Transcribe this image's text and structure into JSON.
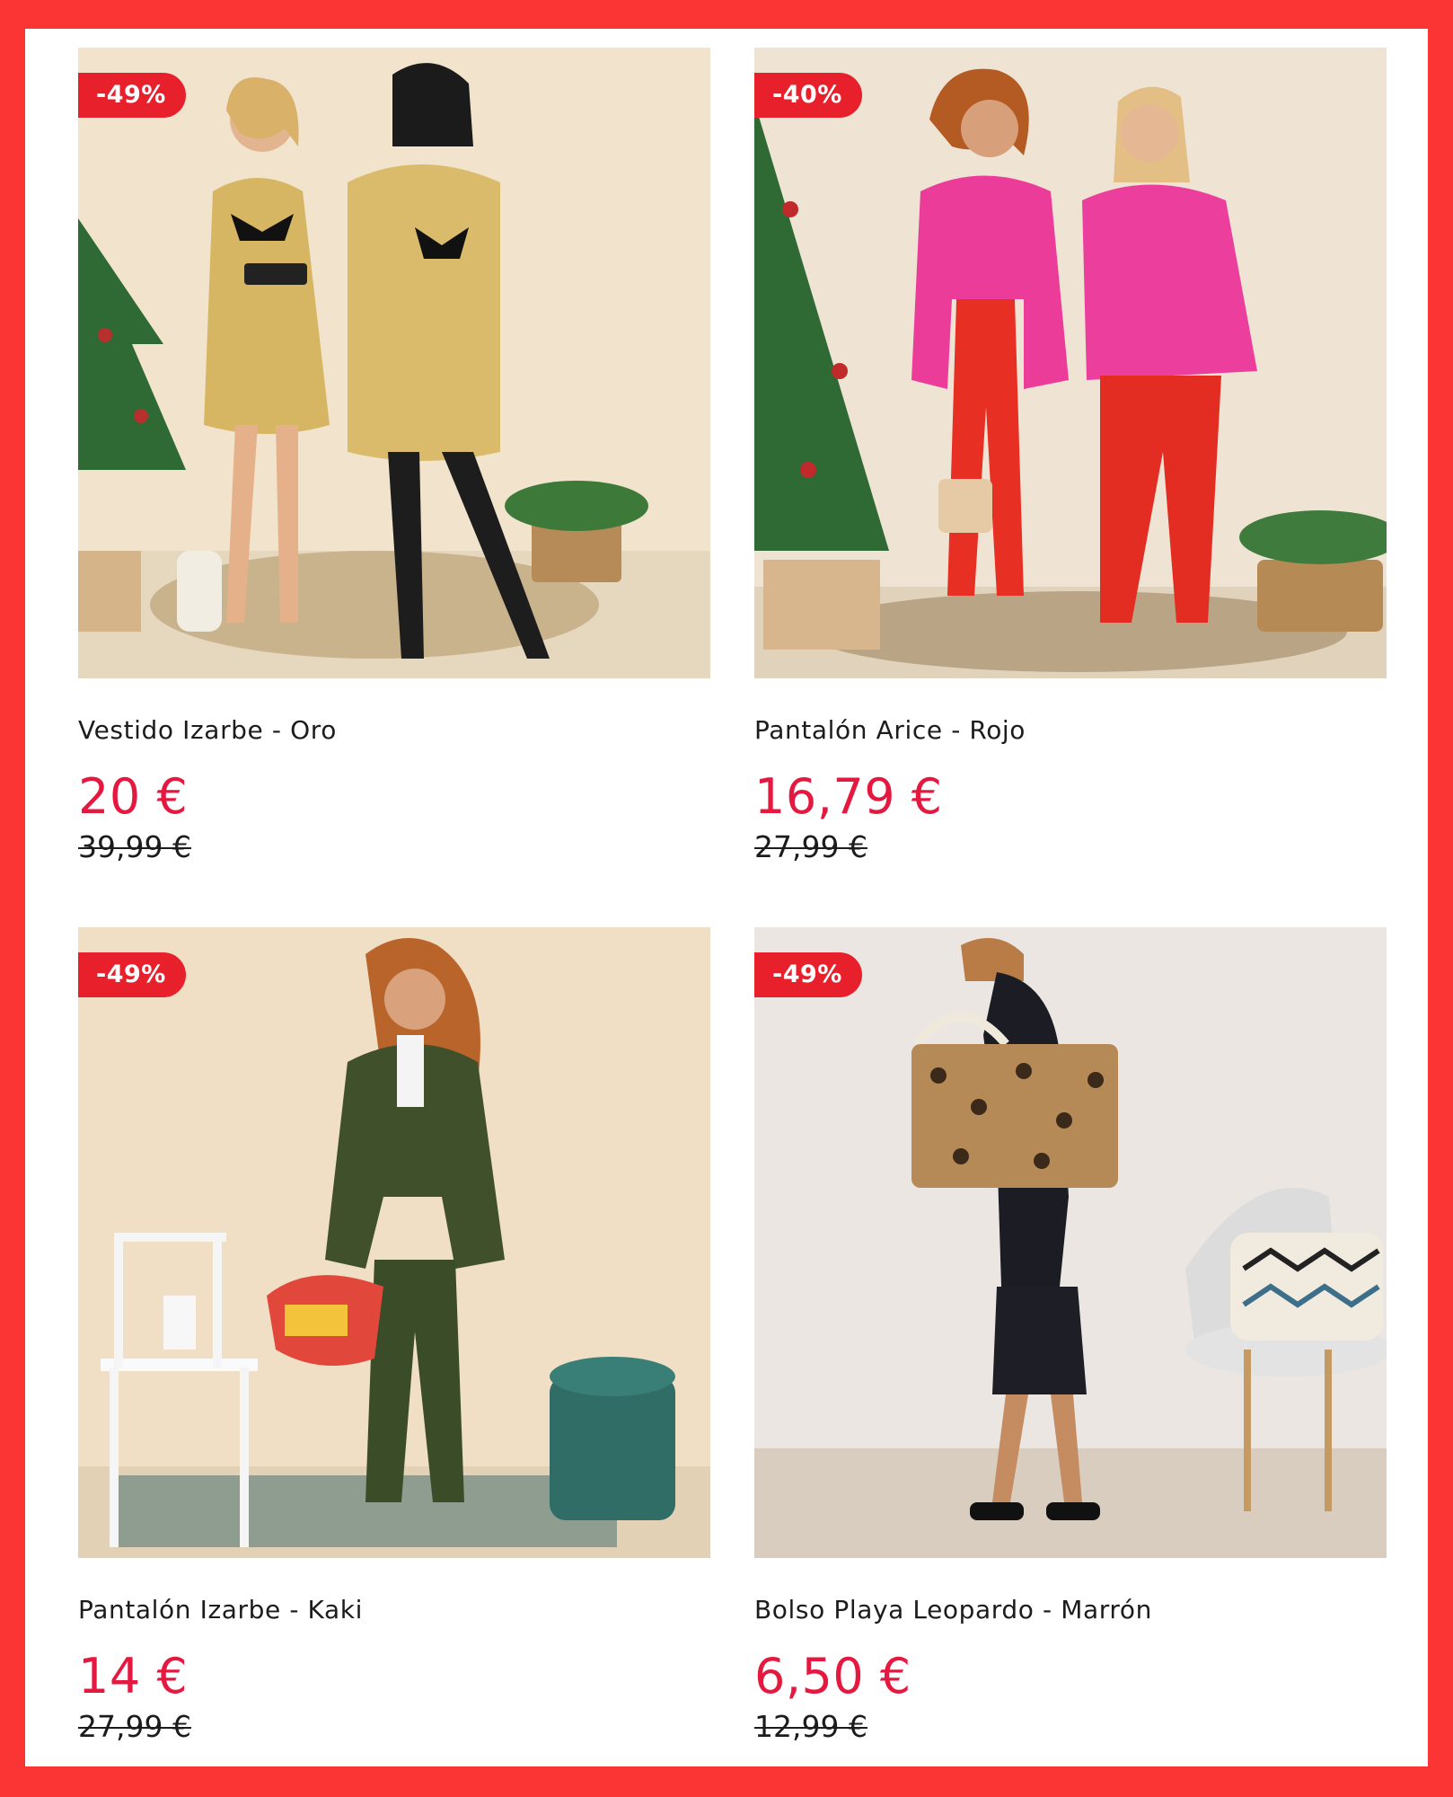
{
  "colors": {
    "frame": "#fb3434",
    "badge": "#e8202c",
    "price": "#e5183f",
    "text": "#1c1c1c"
  },
  "products": [
    {
      "badge": "-49%",
      "name": "Vestido Izarbe - Oro",
      "price": "20 €",
      "old_price": "39,99 €",
      "image": "two-women-gold-sequin-dresses-christmas-tree"
    },
    {
      "badge": "-40%",
      "name": "Pantalón Arice - Rojo",
      "price": "16,79 €",
      "old_price": "27,99 €",
      "image": "two-women-pink-sweaters-red-trousers"
    },
    {
      "badge": "-49%",
      "name": "Pantalón Izarbe - Kaki",
      "price": "14 €",
      "old_price": "27,99 €",
      "image": "woman-khaki-cardigan-trousers-scarf"
    },
    {
      "badge": "-49%",
      "name": "Bolso Playa Leopardo - Marrón",
      "price": "6,50 €",
      "old_price": "12,99 €",
      "image": "woman-black-dress-leopard-tote-bag"
    }
  ]
}
